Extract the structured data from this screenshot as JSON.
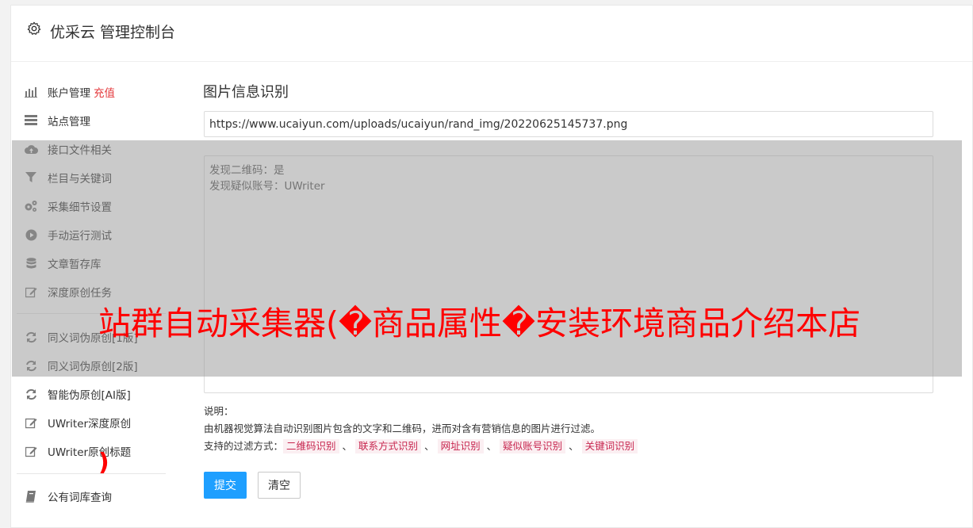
{
  "header": {
    "title": "优采云 管理控制台"
  },
  "sidebar": {
    "items": [
      {
        "label": "账户管理",
        "badge": "充值"
      },
      {
        "label": "站点管理"
      },
      {
        "label": "接口文件相关"
      },
      {
        "label": "栏目与关键词"
      },
      {
        "label": "采集细节设置"
      },
      {
        "label": "手动运行测试"
      },
      {
        "label": "文章暂存库"
      },
      {
        "label": "深度原创任务"
      },
      {
        "label": "同义词伪原创[1版]"
      },
      {
        "label": "同义词伪原创[2版]"
      },
      {
        "label": "智能伪原创[AI版]"
      },
      {
        "label": "UWriter深度原创"
      },
      {
        "label": "UWriter原创标题"
      },
      {
        "label": "公有词库查询"
      }
    ]
  },
  "form": {
    "title": "图片信息识别",
    "url_value": "https://www.ucaiyun.com/uploads/ucaiyun/rand_img/20220625145737.png",
    "result_lines": [
      "发现二维码：是",
      "发现疑似账号：UWriter"
    ],
    "help": {
      "heading": "说明：",
      "description": "由机器视觉算法自动识别图片包含的文字和二维码，进而对含有营销信息的图片进行过滤。",
      "filter_prefix": "支持的过滤方式：",
      "tags": [
        "二维码识别",
        "联系方式识别",
        "网址识别",
        "疑似账号识别",
        "关键词识别"
      ],
      "separator": "、"
    },
    "submit_label": "提交",
    "clear_label": "清空"
  },
  "overlay": {
    "text": "站群自动采集器(�商品属性�安装环境商品介绍本店",
    "paren": ")"
  }
}
